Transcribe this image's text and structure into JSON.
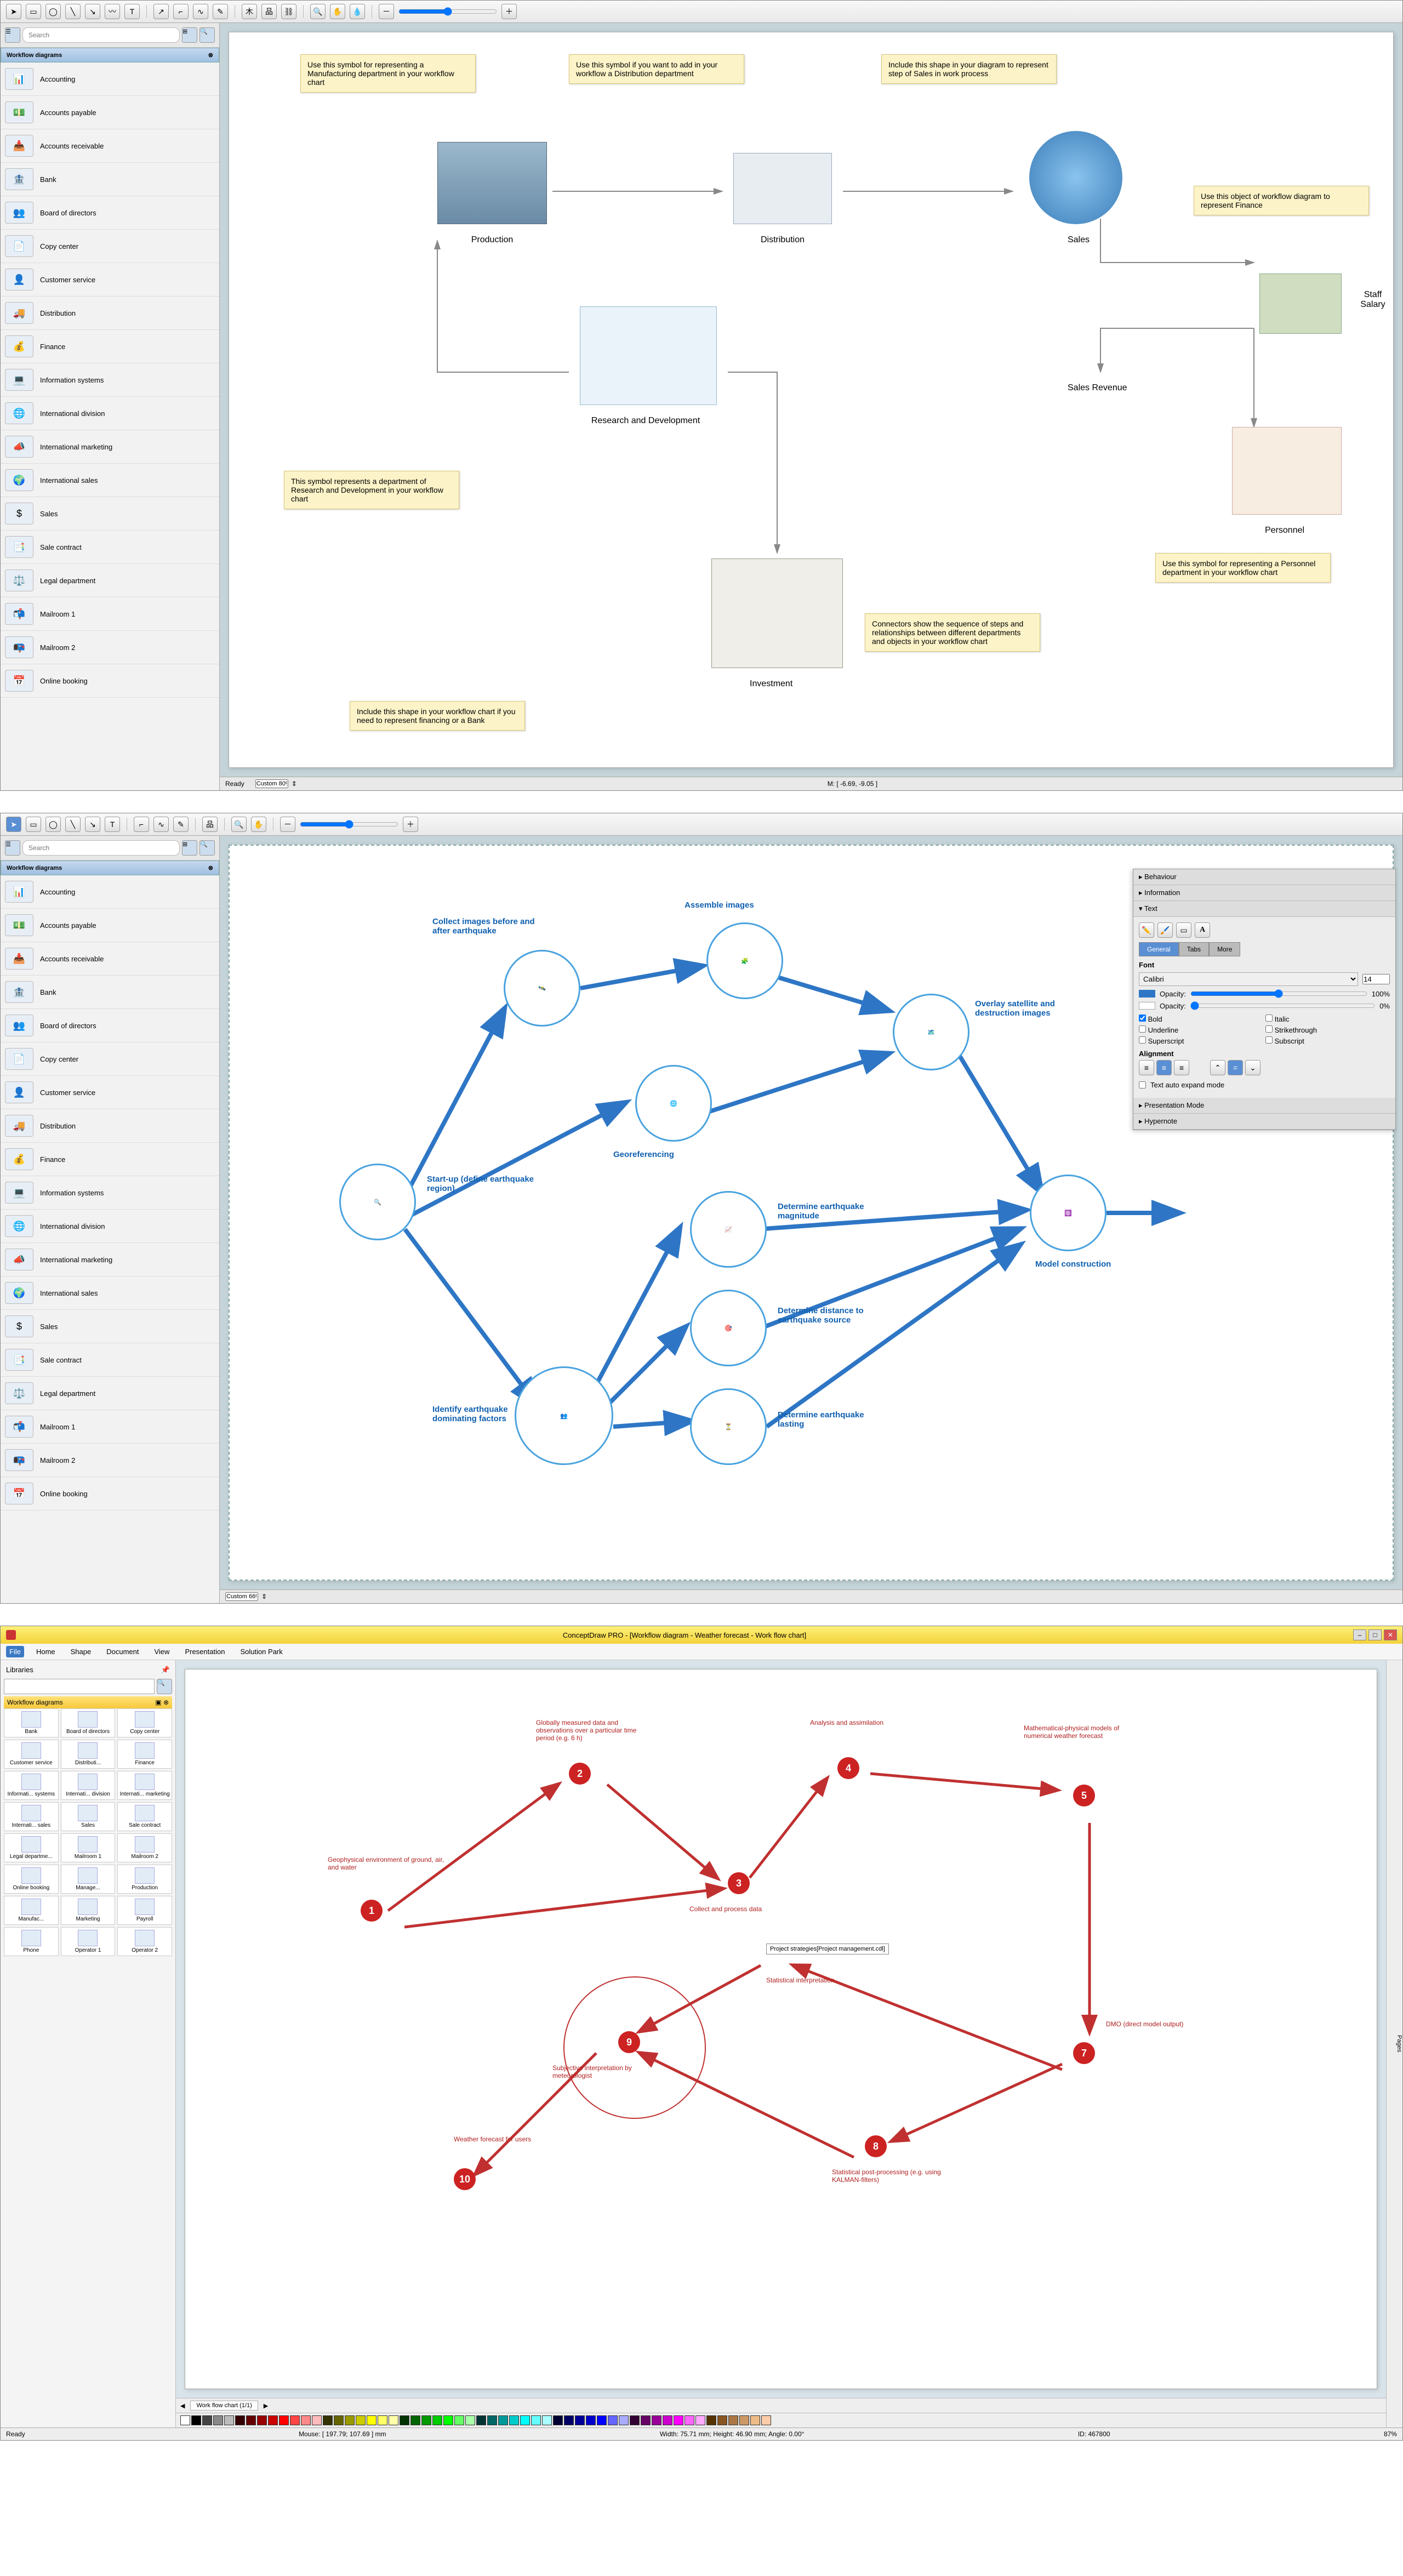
{
  "sidebar": {
    "search_placeholder": "Search",
    "section_title": "Workflow diagrams",
    "items": [
      "Accounting",
      "Accounts payable",
      "Accounts receivable",
      "Bank",
      "Board of directors",
      "Copy center",
      "Customer service",
      "Distribution",
      "Finance",
      "Information systems",
      "International division",
      "International marketing",
      "International sales",
      "Sales",
      "Sale contract",
      "Legal department",
      "Mailroom 1",
      "Mailroom 2",
      "Online booking"
    ]
  },
  "lib_icons": [
    "📊",
    "💵",
    "📥",
    "🏦",
    "👥",
    "📄",
    "👤",
    "🚚",
    "💰",
    "💻",
    "🌐",
    "📣",
    "🌍",
    "$",
    "📑",
    "⚖️",
    "📬",
    "📭",
    "📅"
  ],
  "s1": {
    "notes": {
      "production": "Use this symbol for representing a Manufacturing department in your workflow chart",
      "distribution": "Use this symbol if you want to add in your workflow a Distribution department",
      "sales": "Include this shape in your diagram to represent step of Sales in work process",
      "finance": "Use this object of workflow diagram to represent Finance",
      "rnd": "This symbol represents a department of Research and Development in your workflow chart",
      "investment": "Include this shape in your workflow chart if you need to represent financing or a Bank",
      "connectors": "Connectors show the sequence of steps and relationships between different departments and objects in your workflow chart",
      "personnel": "Use this symbol for representing a Personnel department in your workflow chart"
    },
    "labels": {
      "production": "Production",
      "distribution": "Distribution",
      "sales": "Sales",
      "staff_salary": "Staff Salary",
      "sales_revenue": "Sales Revenue",
      "rnd": "Research and Development",
      "investment": "Investment",
      "personnel": "Personnel"
    },
    "zoom": "Custom 80%",
    "mouse": "M: [ -6.69, -9.05 ]"
  },
  "s2": {
    "nodes": {
      "startup": "Start-up (define earthquake region)",
      "collect": "Collect images before and after earthquake",
      "assemble": "Assemble images",
      "georef": "Georeferencing",
      "overlay": "Overlay satellite and destruction images",
      "magnitude": "Determine earthquake magnitude",
      "distance": "Determine distance to earthquake source",
      "lasting": "Determine earthquake lasting",
      "model": "Model construction",
      "identify": "Identify earthquake dominating factors"
    },
    "zoom": "Custom 66%",
    "inspect": {
      "sections": [
        "Behaviour",
        "Information",
        "Text",
        "Presentation Mode",
        "Hypernote"
      ],
      "tabs": [
        "General",
        "Tabs",
        "More"
      ],
      "font_label": "Font",
      "font": "Calibri",
      "size": "14",
      "opacity_label": "Opacity:",
      "opacity": "100%",
      "opacity2": "0%",
      "checks": [
        "Bold",
        "Italic",
        "Underline",
        "Strikethrough",
        "Superscript",
        "Subscript"
      ],
      "align_label": "Alignment",
      "auto_expand": "Text auto expand mode"
    }
  },
  "s3": {
    "title": "ConceptDraw PRO - [Workflow diagram - Weather forecast - Work flow chart]",
    "menu": [
      "File",
      "Home",
      "Shape",
      "Document",
      "View",
      "Presentation",
      "Solution Park"
    ],
    "libraries_title": "Libraries",
    "lib_section": "Workflow diagrams",
    "lib_items": [
      "Bank",
      "Board of directors",
      "Copy center",
      "Customer service",
      "Distributi...",
      "Finance",
      "Informati... systems",
      "Internati... division",
      "Internati... marketing",
      "Internati... sales",
      "Sales",
      "Sale contract",
      "Legal departme...",
      "Mailroom 1",
      "Mailroom 2",
      "Online booking",
      "Manage...",
      "Production",
      "Manufac...",
      "Marketing",
      "Payroll",
      "Phone",
      "Operator 1",
      "Operator 2"
    ],
    "nodes": {
      "1": "Geophysical environment of ground, air, and water",
      "2": "Globally measured data and observations over a particular time period (e.g. 6 h)",
      "3": "Collect and process data",
      "4": "Analysis and assimilation",
      "5": "Mathematical-physical models of numerical weather forecast",
      "7": "DMO (direct model output)",
      "8": "Statistical post-processing (e.g. using KALMAN-filters)",
      "9": "Subjective interpretation by meteorologist",
      "10": "Weather forecast for users",
      "stat": "Statistical interpretation",
      "strat": "Project strategies[Project management.cdl]"
    },
    "tab": "Work flow chart (1/1)",
    "status": {
      "ready": "Ready",
      "mouse": "Mouse: [ 197.79; 107.69 ] mm",
      "dims": "Width: 75.71 mm; Height: 46.90 mm; Angle: 0.00°",
      "id": "ID: 467800",
      "zoom": "87%"
    },
    "swatches": [
      "#fff",
      "#000",
      "#444",
      "#888",
      "#bbb",
      "#300",
      "#600",
      "#900",
      "#c00",
      "#f00",
      "#f44",
      "#f88",
      "#fbb",
      "#330",
      "#660",
      "#990",
      "#cc0",
      "#ff0",
      "#ff6",
      "#ffa",
      "#030",
      "#060",
      "#090",
      "#0c0",
      "#0f0",
      "#6f6",
      "#afa",
      "#033",
      "#066",
      "#099",
      "#0cc",
      "#0ff",
      "#6ff",
      "#aff",
      "#003",
      "#006",
      "#009",
      "#00c",
      "#00f",
      "#66f",
      "#aaf",
      "#303",
      "#606",
      "#909",
      "#c0c",
      "#f0f",
      "#f6f",
      "#faf",
      "#530",
      "#852",
      "#a74",
      "#c96",
      "#eb8",
      "#fca"
    ]
  }
}
